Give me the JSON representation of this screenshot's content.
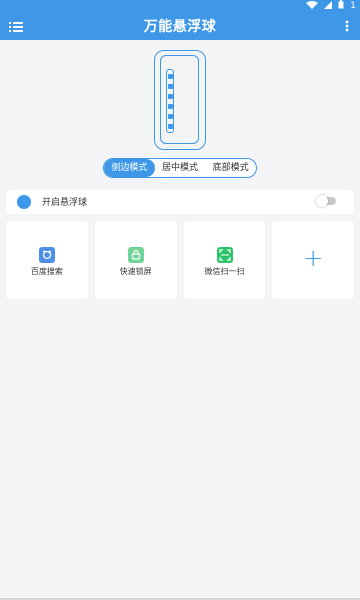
{
  "app": {
    "title": "万能悬浮球",
    "accent": "#3e98e7"
  },
  "status_bar": {
    "battery_text": "1"
  },
  "modes": [
    {
      "label": "侧边模式",
      "active": true
    },
    {
      "label": "居中模式",
      "active": false
    },
    {
      "label": "底部模式",
      "active": false
    }
  ],
  "toggle": {
    "label": "开启悬浮球",
    "enabled": false
  },
  "tiles": [
    {
      "label": "百度搜索",
      "icon": "baidu-search-icon",
      "color": "#4d8ee9"
    },
    {
      "label": "快速锁屏",
      "icon": "lock-screen-icon",
      "color": "#6fd39a"
    },
    {
      "label": "微信扫一扫",
      "icon": "wechat-scan-icon",
      "color": "#2dc36b"
    },
    {
      "label": "+",
      "icon": "add-icon",
      "color": "#3e98e7"
    }
  ]
}
